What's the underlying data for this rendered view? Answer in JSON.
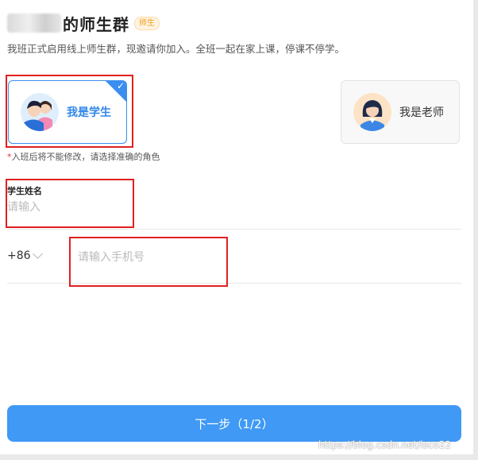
{
  "header": {
    "title": "的师生群",
    "badge": "师生",
    "subtitle": "我班正式启用线上师生群，现邀请你加入。全班一起在家上课，停课不停学。"
  },
  "roles": {
    "student_label": "我是学生",
    "teacher_label": "我是老师",
    "selected": "student"
  },
  "hint": {
    "asterisk": "*",
    "text": "入班后将不能修改，请选择准确的角色"
  },
  "form": {
    "name_label": "学生姓名",
    "name_placeholder": "请输入",
    "country_code": "+86",
    "phone_placeholder": "请输入手机号"
  },
  "footer": {
    "next_button": "下一步（1/2）"
  },
  "watermark": "https://blog.csdn.net/isco22",
  "colors": {
    "accent": "#3f99f5",
    "annotation": "#e02020",
    "badge": "#f29a1b"
  }
}
